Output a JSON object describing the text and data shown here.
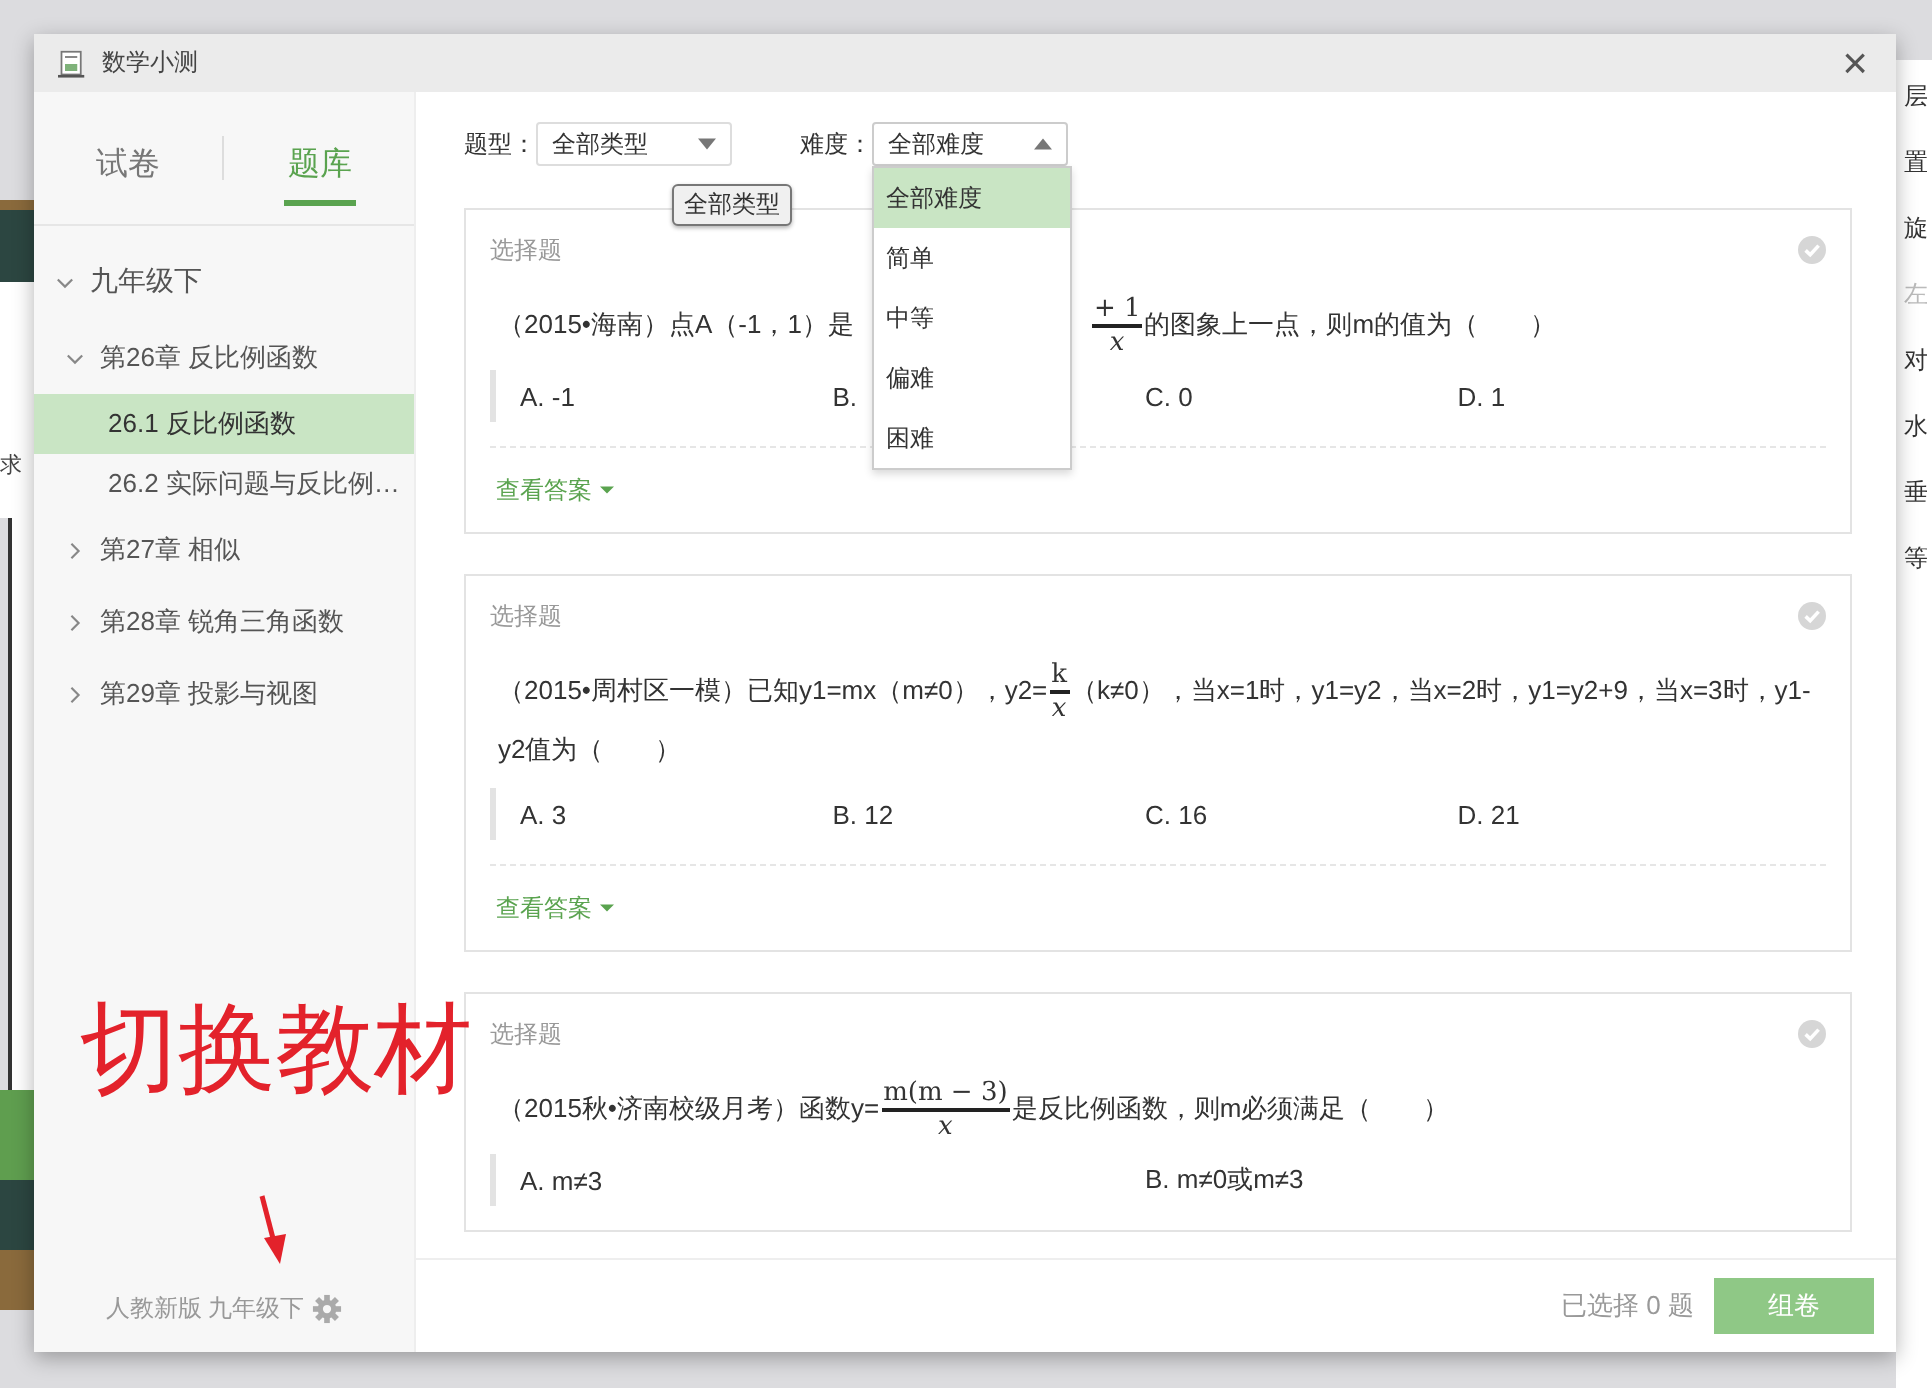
{
  "background": {
    "left_text": "求",
    "right_labels": [
      {
        "text": "层",
        "kind": "label"
      },
      {
        "text": "置",
        "kind": "label"
      },
      {
        "text": "旋",
        "kind": "label"
      },
      {
        "text": "左",
        "kind": "muted"
      },
      {
        "text": "对",
        "kind": "label"
      },
      {
        "text": "水",
        "kind": "label"
      },
      {
        "text": "垂",
        "kind": "label"
      },
      {
        "text": "等",
        "kind": "label"
      }
    ]
  },
  "window": {
    "title": "数学小测",
    "close": "×"
  },
  "sidebar": {
    "tabs": [
      {
        "label": "试卷",
        "selected": false
      },
      {
        "label": "题库",
        "selected": true
      }
    ],
    "tree": [
      {
        "label": "九年级下",
        "expanded": true,
        "selected": false,
        "children": [
          {
            "label": "第26章 反比例函数",
            "expanded": true,
            "selected": false,
            "children": [
              {
                "label": "26.1 反比例函数",
                "selected": true
              },
              {
                "label": "26.2 实际问题与反比例…",
                "selected": false
              }
            ]
          },
          {
            "label": "第27章 相似",
            "expanded": false,
            "selected": false
          },
          {
            "label": "第28章 锐角三角函数",
            "expanded": false,
            "selected": false
          },
          {
            "label": "第29章 投影与视图",
            "expanded": false,
            "selected": false
          }
        ]
      }
    ],
    "textbook": "人教新版 九年级下"
  },
  "filters": [
    {
      "label": "题型：",
      "value": "全部类型",
      "open": false
    },
    {
      "label": "难度：",
      "value": "全部难度",
      "open": true,
      "options": [
        {
          "label": "全部难度",
          "selected": true
        },
        {
          "label": "简单",
          "selected": false
        },
        {
          "label": "中等",
          "selected": false
        },
        {
          "label": "偏难",
          "selected": false
        },
        {
          "label": "困难",
          "selected": false
        }
      ]
    }
  ],
  "tooltip": {
    "text": "全部类型"
  },
  "questions": [
    {
      "type": "选择题",
      "kind": "short",
      "parts": [
        {
          "kind": "text",
          "text": "（2015•海南）点A（-1，1）是"
        },
        {
          "kind": "covered"
        },
        {
          "kind": "fraction",
          "numerator": "+ 1",
          "denominator": "x"
        },
        {
          "kind": "text",
          "text": "的图象上一点，则m的值为（　　）"
        }
      ],
      "options": [
        "A. -1",
        "B.",
        "C. 0",
        "D. 1"
      ],
      "answer_link": "查看答案"
    },
    {
      "type": "选择题",
      "kind": "short",
      "parts": [
        {
          "kind": "text",
          "text": "（2015•周村区一模）已知y1=mx（m≠0），y2="
        },
        {
          "kind": "fraction",
          "numerator": "k",
          "denominator": "x"
        },
        {
          "kind": "text",
          "text": "（k≠0），当x=1时，y1=y2，当x=2时，y1=y2+9，当x=3时，y1-y2值为（　　）"
        }
      ],
      "options": [
        "A. 3",
        "B. 12",
        "C. 16",
        "D. 21"
      ],
      "answer_link": "查看答案"
    },
    {
      "type": "选择题",
      "kind": "long",
      "parts": [
        {
          "kind": "text",
          "text": "（2015秋•济南校级月考）函数y="
        },
        {
          "kind": "fraction",
          "numerator": "m(m − 3)",
          "denominator": "x"
        },
        {
          "kind": "text",
          "text": "是反比例函数，则m必须满足（　　）"
        }
      ],
      "options": [
        "A. m≠3",
        "B. m≠0或m≠3"
      ]
    }
  ],
  "footer": {
    "selected_count": "已选择 0 题",
    "button": {
      "label": "组卷",
      "disabled": true
    }
  },
  "annotation": {
    "text": "切换教材"
  }
}
